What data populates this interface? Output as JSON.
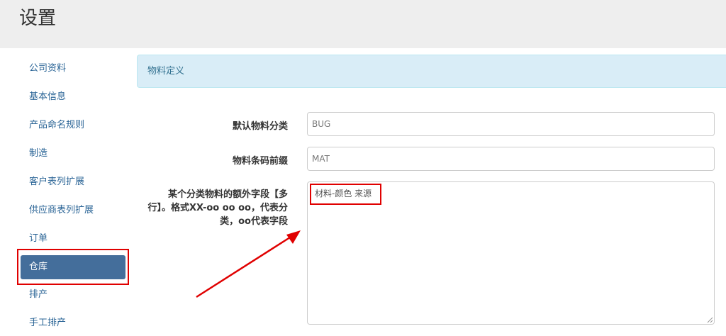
{
  "header": {
    "title": "设置"
  },
  "sidebar": {
    "items": [
      {
        "label": "公司资料"
      },
      {
        "label": "基本信息"
      },
      {
        "label": "产品命名规则"
      },
      {
        "label": "制造"
      },
      {
        "label": "客户表列扩展"
      },
      {
        "label": "供应商表列扩展"
      },
      {
        "label": "订单"
      },
      {
        "label": "仓库",
        "active": true
      },
      {
        "label": "排产"
      },
      {
        "label": "手工排产"
      }
    ]
  },
  "panel": {
    "heading": "物料定义"
  },
  "form": {
    "default_category": {
      "label": "默认物料分类",
      "value": "BUG"
    },
    "barcode_prefix": {
      "label": "物料条码前缀",
      "value": "MAT"
    },
    "extra_fields": {
      "label_line1": "某个分类物料的额外字段【多",
      "label_line2": "行】。格式XX-oo oo oo，代表分",
      "label_line3": "类，oo代表字段",
      "value": "材料-颜色 来源"
    }
  },
  "colors": {
    "accent": "#446e9b",
    "annotation_red": "#e00000",
    "panel_heading_bg": "#d9edf7",
    "header_bg": "#eeeeee"
  }
}
